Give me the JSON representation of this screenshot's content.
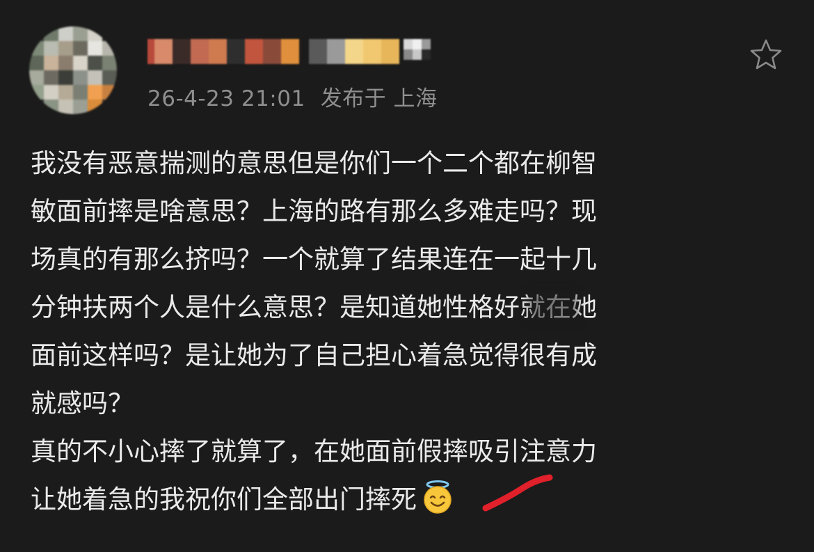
{
  "post": {
    "timestamp": "26-4-23 21:01",
    "location_prefix": "发布于",
    "location": "上海",
    "body_paragraph_1_lines": [
      "我没有恶意揣测的意思但是你们一个二个都在柳智",
      "敏面前摔是啥意思？上海的路有那么多难走吗？现",
      "场真的有那么挤吗？一个就算了结果连在一起十几",
      "分钟扶两个人是什么意思？是知道她性格好就在她",
      "面前这样吗？是让她为了自己担心着急觉得很有成",
      "就感吗？"
    ],
    "body_paragraph_2_lines": [
      "真的不小心摔了就算了，在她面前假摔吸引注意力",
      "让她着急的我祝你们全部出门摔死"
    ],
    "emoji": "smiling-face-with-halo-emoji",
    "icons": {
      "favorite": "star-outline-icon"
    }
  },
  "colors": {
    "background": "#1b1b1b",
    "text": "#eaeaea",
    "meta_text": "#8f8f8f",
    "scribble": "#e0202a"
  }
}
